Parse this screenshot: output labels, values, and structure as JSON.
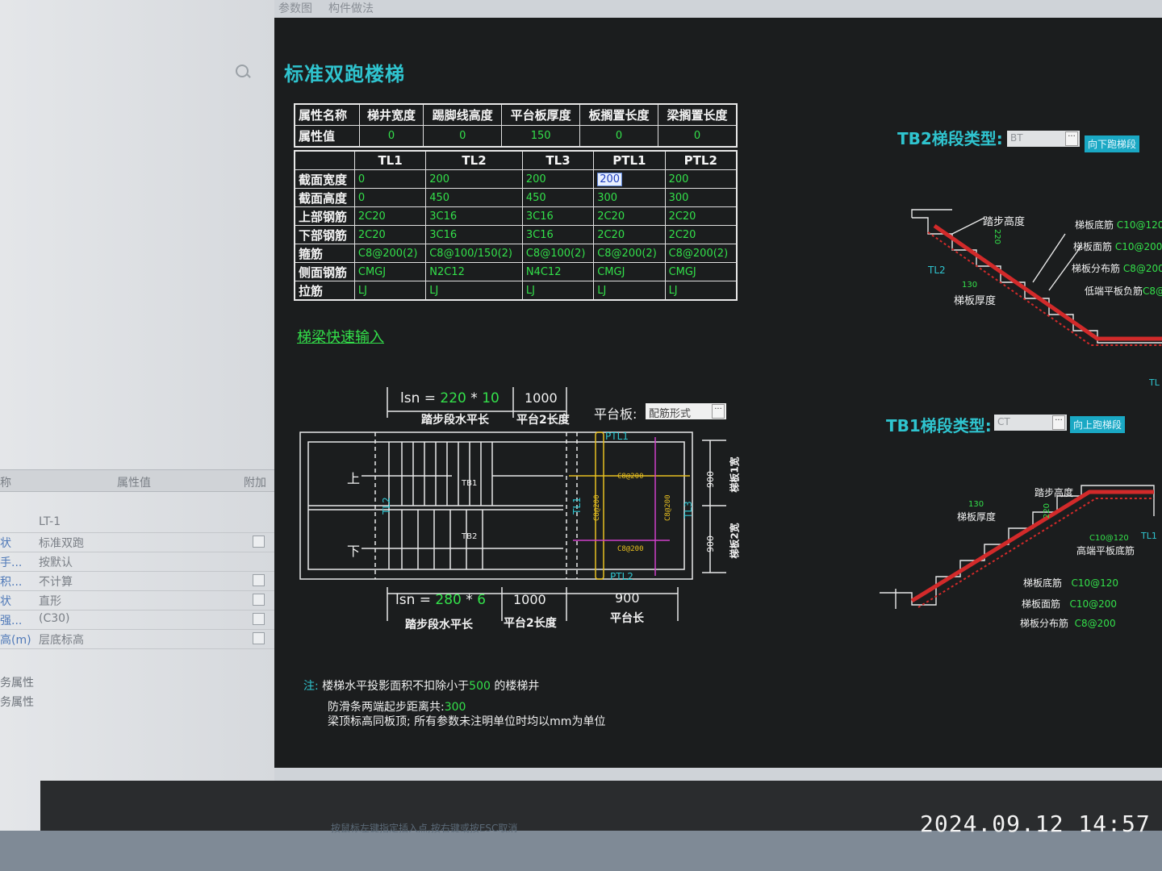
{
  "tabs": [
    "参数图",
    "构件做法"
  ],
  "left_panel": {
    "header": {
      "name": "称",
      "value": "属性值",
      "extra": "附加"
    },
    "rows": [
      {
        "name": "",
        "value": "LT-1"
      },
      {
        "name": "状",
        "value": "标准双跑"
      },
      {
        "name": "手...",
        "value": "按默认"
      },
      {
        "name": "积...",
        "value": "不计算"
      },
      {
        "name": "状",
        "value": "直形"
      },
      {
        "name": "强...",
        "value": "(C30)"
      },
      {
        "name": "高(m)",
        "value": "层底标高"
      }
    ],
    "footer": [
      "务属性",
      "务属性"
    ]
  },
  "main": {
    "title": "标准双跑楼梯",
    "attr_table": {
      "row_labels": [
        "属性名称",
        "属性值"
      ],
      "headers": [
        "梯井宽度",
        "踢脚线高度",
        "平台板厚度",
        "板搁置长度",
        "梁搁置长度"
      ],
      "values": [
        "0",
        "0",
        "150",
        "0",
        "0"
      ]
    },
    "beam_table": {
      "columns": [
        "TL1",
        "TL2",
        "TL3",
        "PTL1",
        "PTL2"
      ],
      "rows": [
        {
          "label": "截面宽度",
          "cells": [
            "0",
            "200",
            "200",
            "200",
            "200"
          ]
        },
        {
          "label": "截面高度",
          "cells": [
            "0",
            "450",
            "450",
            "300",
            "300"
          ]
        },
        {
          "label": "上部钢筋",
          "cells": [
            "2C20",
            "3C16",
            "3C16",
            "2C20",
            "2C20"
          ]
        },
        {
          "label": "下部钢筋",
          "cells": [
            "2C20",
            "3C16",
            "3C16",
            "2C20",
            "2C20"
          ]
        },
        {
          "label": "箍筋",
          "cells": [
            "C8@200(2)",
            "C8@100/150(2)",
            "C8@100(2)",
            "C8@200(2)",
            "C8@200(2)"
          ]
        },
        {
          "label": "侧面钢筋",
          "cells": [
            "CMGJ",
            "N2C12",
            "N4C12",
            "CMGJ",
            "CMGJ"
          ]
        },
        {
          "label": "拉筋",
          "cells": [
            "LJ",
            "LJ",
            "LJ",
            "LJ",
            "LJ"
          ]
        }
      ]
    },
    "quick_input": "梯梁快速输入",
    "plan": {
      "top_dim": {
        "lsn": "lsn",
        "eq": "=",
        "a": "220",
        "mul": "*",
        "b": "10",
        "c": "1000",
        "label1": "踏步段水平长",
        "label2": "平台2长度"
      },
      "bottom_dim": {
        "lsn": "lsn",
        "eq": "=",
        "a": "280",
        "mul": "*",
        "b": "6",
        "c": "1000",
        "d": "900",
        "label1": "踏步段水平长",
        "label2": "平台2长度",
        "label3": "平台长"
      },
      "platform_label": "平台板:",
      "platform_value": "配筋形式",
      "up": "上",
      "down": "下",
      "tb1": "TB1",
      "tb2": "TB2",
      "tl1": "TL1",
      "tl2": "TL2",
      "tl3": "TL3",
      "ptl1": "PTL1",
      "ptl2": "PTL2",
      "rebar_h1": "C8@200",
      "rebar_h2": "C8@200",
      "rebar_v1": "C8@200",
      "rebar_v2": "C8@200",
      "w1": "900",
      "w1_label": "梯板1宽",
      "w2": "900",
      "w2_label": "梯板2宽"
    },
    "tb2": {
      "title": "TB2梯段类型:",
      "combo": "BT",
      "button": "向下跑梯段",
      "labels": {
        "step_h": "踏步高度",
        "h220": "220",
        "thick": "130",
        "thick_label": "梯板厚度",
        "tl2": "TL2",
        "l1": "梯板底筋",
        "v1": "C10@120",
        "l2": "梯板面筋",
        "v2": "C10@200",
        "l3": "梯板分布筋",
        "v3": "C8@200",
        "l4": "低端平板负筋",
        "v4": "C8@200",
        "tl": "TL"
      }
    },
    "tb1": {
      "title": "TB1梯段类型:",
      "combo": "CT",
      "button": "向上跑梯段",
      "labels": {
        "step_h": "踏步高度",
        "h220": "220",
        "thick": "130",
        "thick_label": "梯板厚度",
        "tl1": "TL1",
        "l0": "高端平板底筋",
        "v0": "C10@120",
        "l1": "梯板底筋",
        "v1": "C10@120",
        "l2": "梯板面筋",
        "v2": "C10@200",
        "l3": "梯板分布筋",
        "v3": "C8@200"
      }
    },
    "notes": {
      "prefix": "注:",
      "line1a": "楼梯水平投影面积不扣除小于",
      "line1v": "500",
      "line1b": "的楼梯井",
      "line2a": "防滑条两端起步距离共:",
      "line2v": "300",
      "line3": "梁顶标高同板顶; 所有参数未注明单位时均以mm为单位"
    }
  },
  "status_bar": "按鼠标左键指定插入点,按右键或按ESC取消",
  "timestamp": "2024.09.12   14:57",
  "colors": {
    "canvas": "#1b1d1e",
    "cyan": "#2fc4cf",
    "green": "#33e04a",
    "red": "#d22a2a",
    "yellow": "#e8c020",
    "magenta": "#d040c8"
  }
}
